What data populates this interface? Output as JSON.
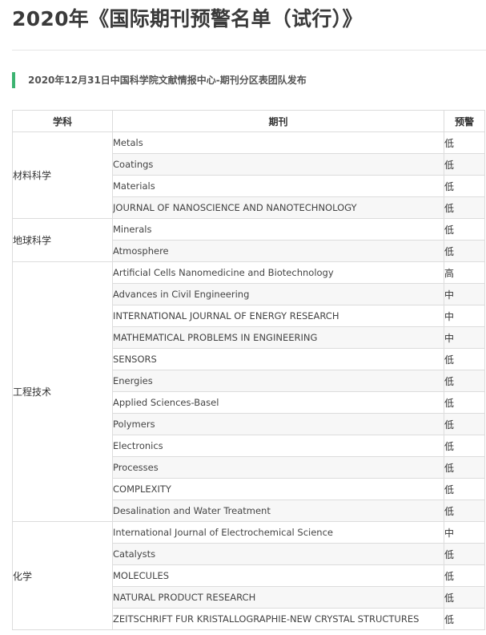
{
  "page": {
    "title": "2020年《国际期刊预警名单（试行）》",
    "subtitle": "2020年12月31日中国科学院文献情报中心-期刊分区表团队发布"
  },
  "table": {
    "headers": [
      "学科",
      "期刊",
      "预警"
    ],
    "groups": [
      {
        "subject": "材料科学",
        "rows": [
          {
            "journal": "Metals",
            "level": "低"
          },
          {
            "journal": "Coatings",
            "level": "低"
          },
          {
            "journal": "Materials",
            "level": "低"
          },
          {
            "journal": "JOURNAL OF NANOSCIENCE AND NANOTECHNOLOGY",
            "level": "低"
          }
        ]
      },
      {
        "subject": "地球科学",
        "rows": [
          {
            "journal": "Minerals",
            "level": "低"
          },
          {
            "journal": "Atmosphere",
            "level": "低"
          }
        ]
      },
      {
        "subject": "工程技术",
        "rows": [
          {
            "journal": "Artificial Cells Nanomedicine and Biotechnology",
            "level": "高"
          },
          {
            "journal": "Advances in Civil Engineering",
            "level": "中"
          },
          {
            "journal": "INTERNATIONAL JOURNAL OF ENERGY RESEARCH",
            "level": "中"
          },
          {
            "journal": "MATHEMATICAL PROBLEMS IN ENGINEERING",
            "level": "中"
          },
          {
            "journal": "SENSORS",
            "level": "低"
          },
          {
            "journal": "Energies",
            "level": "低"
          },
          {
            "journal": "Applied Sciences-Basel",
            "level": "低"
          },
          {
            "journal": "Polymers",
            "level": "低"
          },
          {
            "journal": "Electronics",
            "level": "低"
          },
          {
            "journal": "Processes",
            "level": "低"
          },
          {
            "journal": "COMPLEXITY",
            "level": "低"
          },
          {
            "journal": "Desalination and Water Treatment",
            "level": "低"
          }
        ]
      },
      {
        "subject": "化学",
        "rows": [
          {
            "journal": "International Journal of Electrochemical Science",
            "level": "中"
          },
          {
            "journal": "Catalysts",
            "level": "低"
          },
          {
            "journal": "MOLECULES",
            "level": "低"
          },
          {
            "journal": "NATURAL PRODUCT RESEARCH",
            "level": "低"
          },
          {
            "journal": "ZEITSCHRIFT FUR KRISTALLOGRAPHIE-NEW CRYSTAL STRUCTURES",
            "level": "低"
          }
        ]
      }
    ]
  }
}
